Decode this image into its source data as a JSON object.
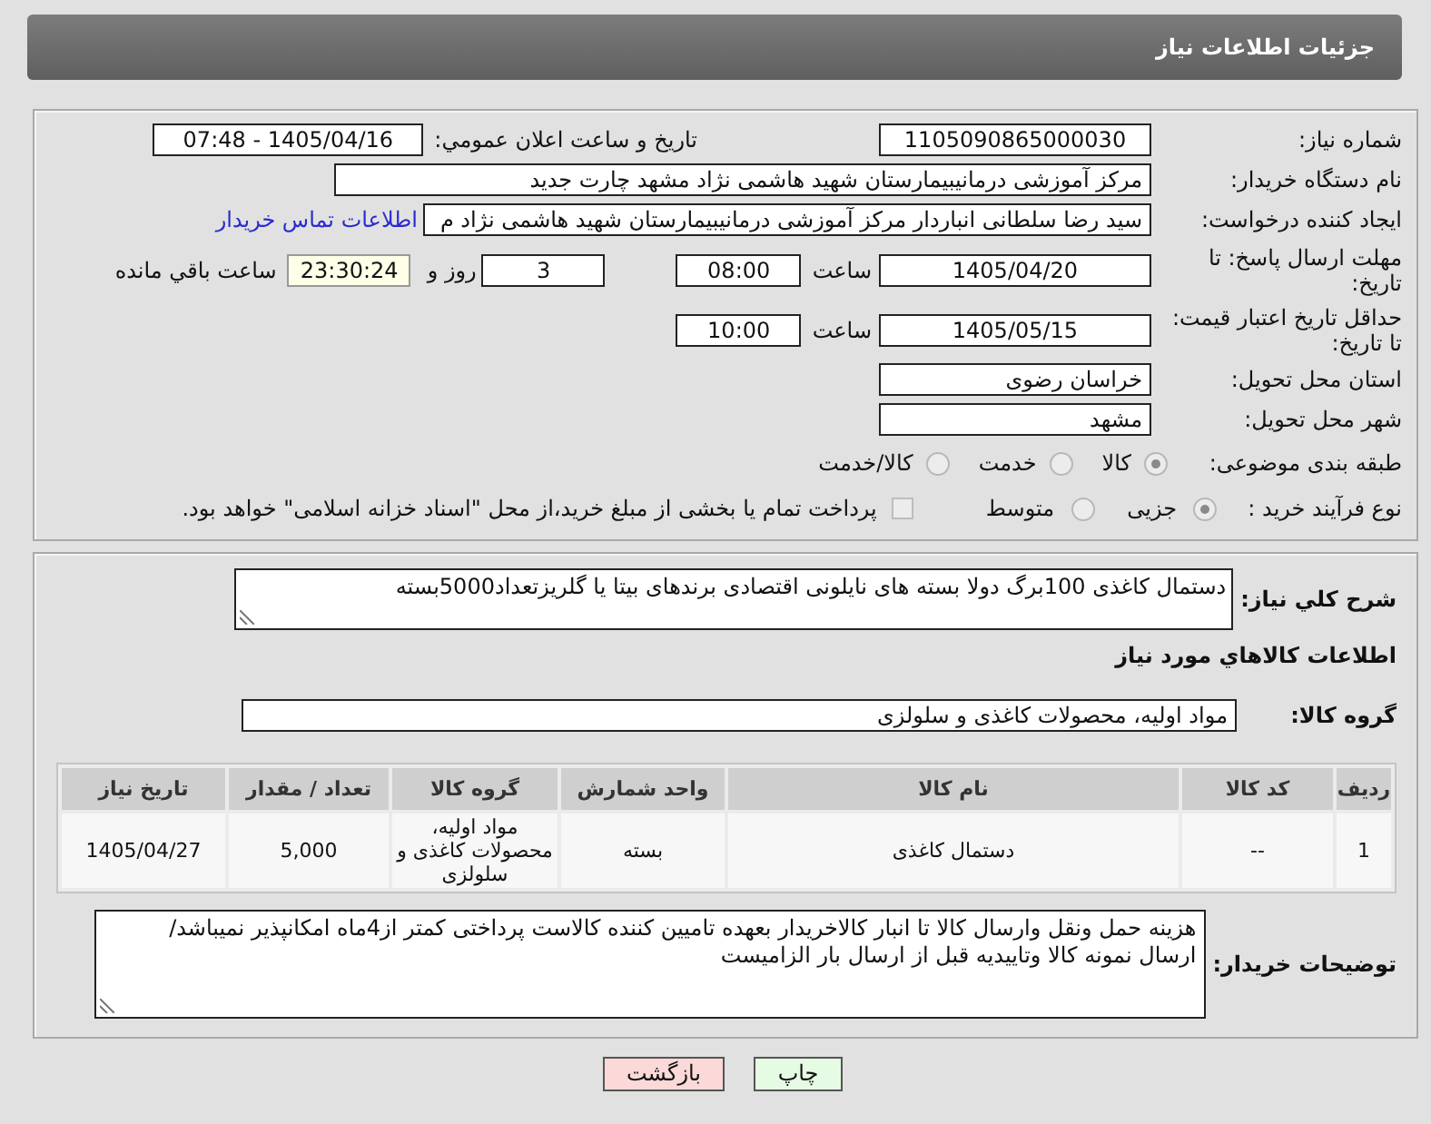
{
  "header": {
    "title": "جزئیات اطلاعات نیاز"
  },
  "details": {
    "need_number": {
      "label": "شماره نیاز:",
      "value": "1105090865000030"
    },
    "announcement": {
      "label": "تاریخ و ساعت اعلان عمومي:",
      "value": "1405/04/16 - 07:48"
    },
    "buyer_org": {
      "label": "نام دستگاه خریدار:",
      "value": "مرکز آموزشی درمانیبیمارستان شهید هاشمی نژاد مشهد چارت جدید"
    },
    "requester": {
      "label": "ایجاد کننده درخواست:",
      "value": "سید رضا سلطانی انباردار مرکز آموزشی درمانیبیمارستان شهید هاشمی نژاد م",
      "contact_link": "اطلاعات تماس خریدار"
    },
    "response_deadline": {
      "label": "مهلت ارسال پاسخ: تا تاریخ:",
      "date": "1405/04/20",
      "time_label": "ساعت",
      "time": "08:00",
      "days": "3",
      "days_label": "روز و",
      "remaining": "23:30:24",
      "remaining_label": "ساعت باقي مانده"
    },
    "price_validity": {
      "label": "حداقل تاریخ اعتبار قیمت: تا تاریخ:",
      "date": "1405/05/15",
      "time_label": "ساعت",
      "time": "10:00"
    },
    "province": {
      "label": "استان محل تحویل:",
      "value": "خراسان رضوی"
    },
    "city": {
      "label": "شهر محل تحویل:",
      "value": "مشهد"
    },
    "category": {
      "label": "طبقه بندی موضوعی:",
      "options": [
        {
          "label": "کالا",
          "selected": true,
          "disabled": true
        },
        {
          "label": "خدمت",
          "selected": false,
          "disabled": true
        },
        {
          "label": "کالا/خدمت",
          "selected": false,
          "disabled": true
        }
      ]
    },
    "process": {
      "label": "نوع فرآیند خرید :",
      "options": [
        {
          "label": "جزیی",
          "selected": true,
          "disabled": true
        },
        {
          "label": "متوسط",
          "selected": false,
          "disabled": true
        }
      ],
      "treasury": {
        "label": "پرداخت تمام یا بخشی از مبلغ خرید،از محل \"اسناد خزانه اسلامی\" خواهد بود.",
        "checked": false,
        "disabled": true
      }
    }
  },
  "summary": {
    "label": "شرح کلي نیاز:",
    "value": "دستمال کاغذی 100برگ دولا بسته های نایلونی اقتصادی برندهای بیتا یا گلریزتعداد5000بسته"
  },
  "goods": {
    "title": "اطلاعات کالاهاي مورد نیاز",
    "group_label": "گروه کالا:",
    "group_value": "مواد اولیه، محصولات کاغذی و سلولزی",
    "table": {
      "columns": [
        "ردیف",
        "کد کالا",
        "نام کالا",
        "واحد شمارش",
        "گروه کالا",
        "تعداد / مقدار",
        "تاریخ نیاز"
      ],
      "rows": [
        [
          "1",
          "--",
          "دستمال کاغذی",
          "بسته",
          "مواد اولیه، محصولات کاغذی و سلولزی",
          "5,000",
          "1405/04/27"
        ]
      ]
    }
  },
  "buyer_notes": {
    "label": "توضیحات خریدار:",
    "value": "هزینه حمل ونقل وارسال کالا تا انبار کالاخریدار بعهده تامیین کننده کالاست پرداختی کمتر از4ماه امکانپذیر نمیباشد/ارسال نمونه کالا وتاییدیه قبل از ارسال بار الزامیست"
  },
  "buttons": [
    {
      "label": "چاپ",
      "kind": "print"
    },
    {
      "label": "بازگشت",
      "kind": "back"
    }
  ]
}
